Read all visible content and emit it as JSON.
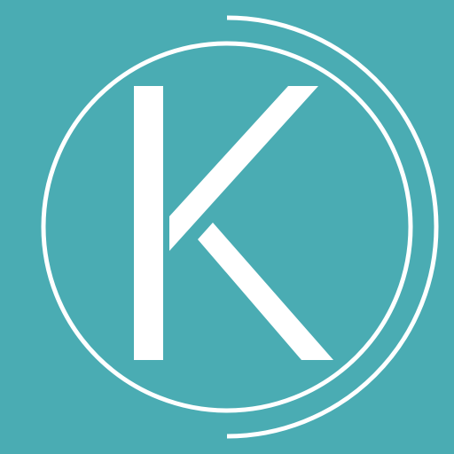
{
  "logo": {
    "letter": "K",
    "background_color": "#4aacb3",
    "foreground_color": "#ffffff"
  }
}
